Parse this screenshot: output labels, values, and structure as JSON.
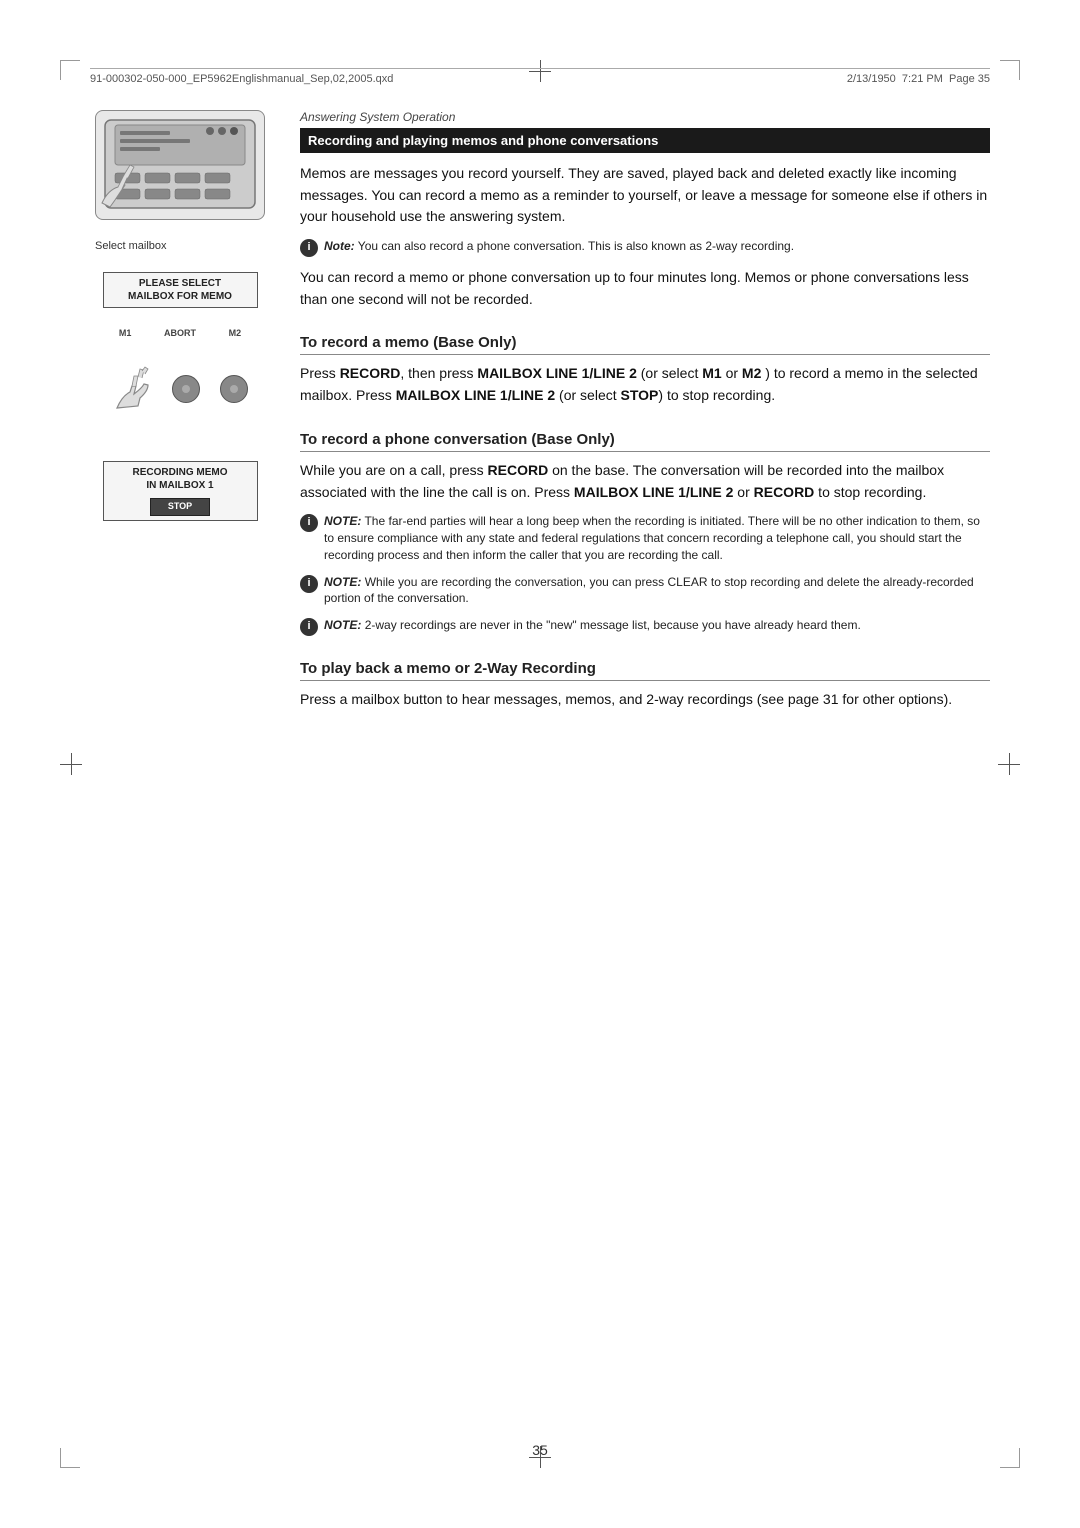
{
  "file_info": {
    "filename": "91-000302-050-000_EP5962Englishmanual_Sep,02,2005.qxd",
    "date": "2/13/1950",
    "time": "7:21 PM",
    "page": "Page 35"
  },
  "section_label": "Answering System Operation",
  "header_bar": "Recording and playing memos and phone conversations",
  "body1": "Memos are messages you record yourself. They are saved, played back and deleted exactly like incoming messages. You can record a memo as a reminder to yourself, or leave a message for someone else if others in your household use the answering system.",
  "note1": {
    "prefix": "Note:",
    "text": "You can also record a phone conversation. This is also known as 2-way recording."
  },
  "body2": "You can record a memo or phone conversation up to four minutes long.  Memos or phone conversations less than one second will not be recorded.",
  "subsection1": {
    "title": "To record a memo (Base Only)",
    "text1_pre": "Press ",
    "text1_bold1": "RECORD",
    "text1_mid1": ", then press ",
    "text1_bold2": "MAILBOX LINE 1/LINE 2",
    "text1_mid2": " (or select ",
    "text1_bold3": "M1",
    "text1_mid3": " or ",
    "text1_bold4": "M2",
    "text1_mid4": " ) to record a memo in the selected mailbox.  Press ",
    "text1_bold5": "MAILBOX LINE 1/LINE 2",
    "text1_mid5": " (or select ",
    "text1_bold6": "STOP",
    "text1_end": ") to stop recording."
  },
  "subsection2": {
    "title": "To record a phone conversation (Base Only)",
    "text1_pre": "While you are on a call, press ",
    "text1_bold1": "RECORD",
    "text1_mid1": " on the base. The conversation will be recorded into the mailbox associated with the line the call is on.  Press ",
    "text1_bold2": "MAILBOX LINE 1/LINE 2",
    "text1_mid2": " or ",
    "text1_bold3": "RECORD",
    "text1_end": " to stop recording."
  },
  "note2": {
    "prefix": "NOTE:",
    "text": "The far-end parties will hear a long beep when the recording is initiated. There will be no other indication to them, so to ensure compliance with any state and federal regulations that concern recording a telephone call, you should start the recording process and then inform the caller that you are recording the call."
  },
  "note3": {
    "prefix": "NOTE:",
    "text": "While you are recording the conversation, you can press CLEAR to stop recording and delete the already-recorded portion of the conversation."
  },
  "note4": {
    "prefix": "NOTE:",
    "text": "2-way recordings are never in the \"new\" message list, because you have already heard them."
  },
  "subsection3": {
    "title": "To play back a memo or 2-Way Recording",
    "text": "Press a mailbox button to hear messages, memos, and 2-way recordings (see page 31 for other options)."
  },
  "lcd_display": {
    "line1": "PLEASE SELECT",
    "line2": "MAILBOX FOR MEMO"
  },
  "button_labels": {
    "m1": "M1",
    "abort": "ABORT",
    "m2": "M2"
  },
  "recording_display": {
    "line1": "RECORDING MEMO",
    "line2": "IN MAILBOX 1"
  },
  "stop_label": "STOP",
  "select_mailbox_label": "Select mailbox",
  "page_number": "35"
}
